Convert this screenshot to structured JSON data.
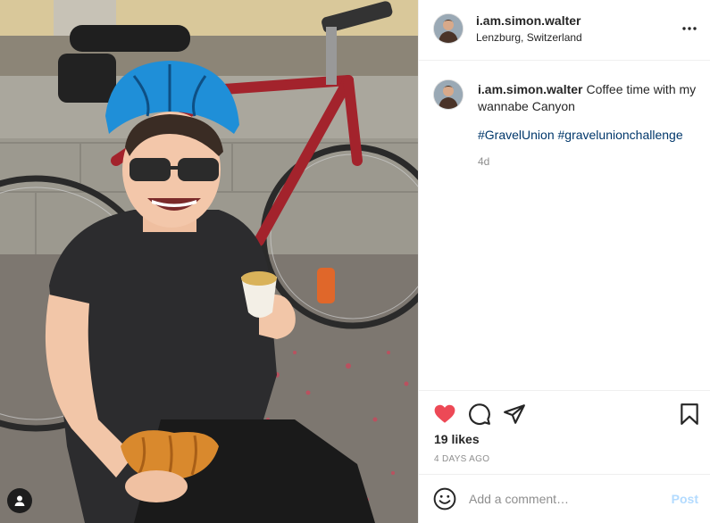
{
  "post": {
    "username": "i.am.simon.walter",
    "location": "Lenzburg, Switzerland",
    "caption": "Coffee time with my wannabe Canyon",
    "hashtags": [
      "#GravelUnion",
      "#gravelunionchallenge"
    ],
    "age": "4d",
    "likes": "19 likes",
    "date": "4 DAYS AGO"
  },
  "comment_box": {
    "placeholder": "Add a comment…",
    "post_label": "Post"
  },
  "icons": {
    "more": "more-options-icon",
    "like": "heart-icon",
    "comment": "comment-icon",
    "share": "paper-plane-icon",
    "save": "bookmark-icon",
    "emoji": "smiley-icon",
    "tags": "user-tag-icon"
  },
  "colors": {
    "like_active": "#ed4956",
    "hashtag": "#00376b",
    "muted": "#8e8e8e",
    "post_disabled": "#b3dbff"
  }
}
